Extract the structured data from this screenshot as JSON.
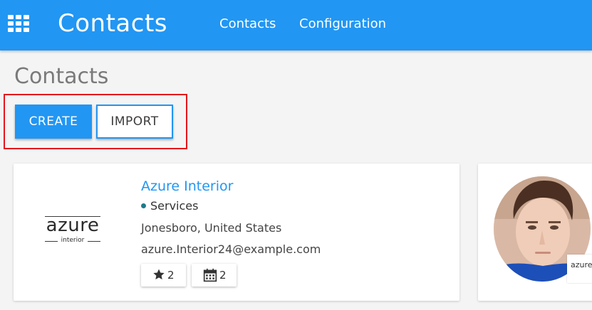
{
  "topbar": {
    "apps_icon": "grid-apps-icon",
    "app_title": "Contacts",
    "nav": [
      {
        "label": "Contacts"
      },
      {
        "label": "Configuration"
      }
    ],
    "color": "#2196f3"
  },
  "page": {
    "title": "Contacts"
  },
  "actions": {
    "create_label": "CREATE",
    "import_label": "IMPORT",
    "highlight_color": "#e5161c"
  },
  "cards": [
    {
      "logo_word": "azure",
      "logo_sub": "interior",
      "name": "Azure Interior",
      "tag": "Services",
      "tag_color": "#1f7a8c",
      "location": "Jonesboro, United States",
      "email": "azure.Interior24@example.com",
      "badges": [
        {
          "icon": "star-icon",
          "count": "2"
        },
        {
          "icon": "calendar-icon",
          "count": "2"
        }
      ]
    },
    {
      "avatar": "person-photo",
      "corner_logo_text": "azure"
    }
  ]
}
